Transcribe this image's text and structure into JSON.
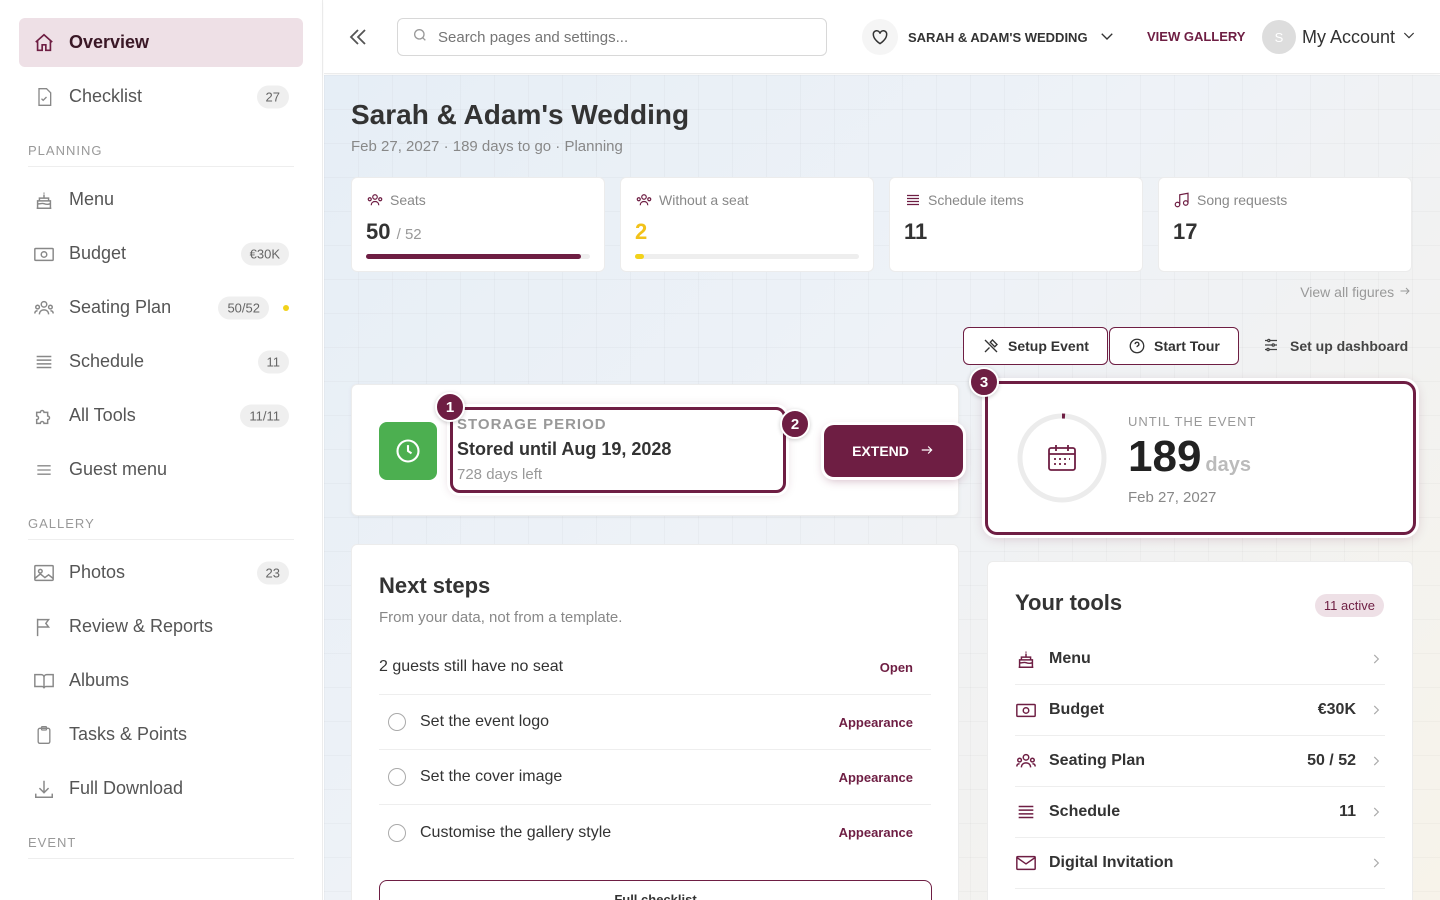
{
  "sidebar": {
    "overview": "Overview",
    "checklist": {
      "label": "Checklist",
      "badge": "27"
    },
    "planning_label": "PLANNING",
    "menu": "Menu",
    "budget": {
      "label": "Budget",
      "badge": "€30K"
    },
    "seating": {
      "label": "Seating Plan",
      "badge": "50/52"
    },
    "schedule": {
      "label": "Schedule",
      "badge": "11"
    },
    "all_tools": {
      "label": "All Tools",
      "badge": "11/11"
    },
    "guest_menu": "Guest menu",
    "gallery_label": "GALLERY",
    "photos": {
      "label": "Photos",
      "badge": "23"
    },
    "review": "Review & Reports",
    "albums": "Albums",
    "tasks": "Tasks & Points",
    "download": "Full Download",
    "event_label": "EVENT"
  },
  "topbar": {
    "search_placeholder": "Search pages and settings...",
    "event_name": "SARAH & ADAM'S WEDDING",
    "view_gallery": "VIEW GALLERY",
    "avatar_initial": "S",
    "account": "My Account"
  },
  "page": {
    "title": "Sarah & Adam's Wedding",
    "subtitle": "Feb 27, 2027 · 189 days to go · Planning"
  },
  "stats": [
    {
      "label": "Seats",
      "value": "50",
      "of": "/ 52",
      "progress": 0.96,
      "color": "#6e1e43"
    },
    {
      "label": "Without a seat",
      "value": "2",
      "progress": 0.04,
      "color": "#f2d21a"
    },
    {
      "label": "Schedule items",
      "value": "11"
    },
    {
      "label": "Song requests",
      "value": "17"
    }
  ],
  "view_all": "View all figures",
  "actions": {
    "setup": "Setup Event",
    "tour": "Start Tour",
    "dashboard": "Set up dashboard"
  },
  "storage": {
    "title": "STORAGE PERIOD",
    "stored": "Stored until Aug 19, 2028",
    "left": "728 days left",
    "extend": "EXTEND"
  },
  "badges": {
    "one": "1",
    "two": "2",
    "three": "3"
  },
  "countdown": {
    "label": "UNTIL THE EVENT",
    "number": "189",
    "unit": "days",
    "date": "Feb 27, 2027"
  },
  "next_steps": {
    "title": "Next steps",
    "subtitle": "From your data, not from a template.",
    "rows": [
      {
        "text": "2 guests still have no seat",
        "action": "Open"
      },
      {
        "text": "Set the event logo",
        "action": "Appearance"
      },
      {
        "text": "Set the cover image",
        "action": "Appearance"
      },
      {
        "text": "Customise the gallery style",
        "action": "Appearance"
      }
    ],
    "full_checklist": "Full checklist"
  },
  "tools": {
    "title": "Your tools",
    "active": "11 active",
    "rows": [
      {
        "label": "Menu",
        "value": ""
      },
      {
        "label": "Budget",
        "value": "€30K"
      },
      {
        "label": "Seating Plan",
        "value": "50 / 52"
      },
      {
        "label": "Schedule",
        "value": "11"
      },
      {
        "label": "Digital Invitation",
        "value": ""
      }
    ]
  },
  "colors": {
    "accent": "#6e1e43",
    "green": "#4caf50",
    "yellow": "#f2d21a"
  }
}
